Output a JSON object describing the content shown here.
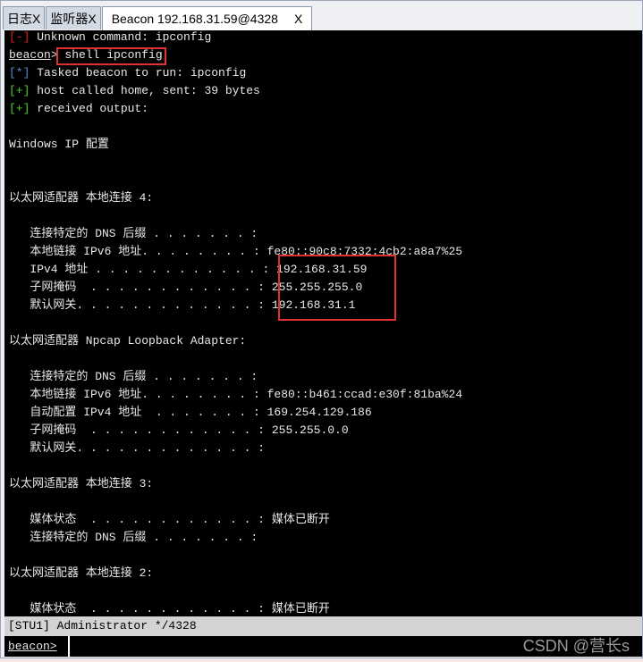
{
  "tabs": [
    {
      "label": "日志X"
    },
    {
      "label": "监听器X"
    },
    {
      "label": "Beacon 192.168.31.59@4328",
      "close": "X"
    }
  ],
  "terminal": {
    "lines": [
      {
        "prefix": "[-]",
        "prefix_color": "red",
        "text": " Unknown command: ipconfig"
      },
      {
        "prompt": "beacon",
        "text": "> shell ipconfig"
      },
      {
        "prefix": "[*]",
        "prefix_color": "blue",
        "text": " Tasked beacon to run: ipconfig"
      },
      {
        "prefix": "[+]",
        "prefix_color": "green",
        "text": " host called home, sent: 39 bytes"
      },
      {
        "prefix": "[+]",
        "prefix_color": "green",
        "text": " received output:"
      },
      {
        "text": ""
      },
      {
        "text": "Windows IP 配置"
      },
      {
        "text": ""
      },
      {
        "text": ""
      },
      {
        "text": "以太网适配器 本地连接 4:"
      },
      {
        "text": ""
      },
      {
        "text": "   连接特定的 DNS 后缀 . . . . . . . :"
      },
      {
        "text": "   本地链接 IPv6 地址. . . . . . . . : fe80::90c8:7332:4cb2:a8a7%25"
      },
      {
        "text": "   IPv4 地址 . . . . . . . . . . . . : 192.168.31.59"
      },
      {
        "text": "   子网掩码  . . . . . . . . . . . . : 255.255.255.0"
      },
      {
        "text": "   默认网关. . . . . . . . . . . . . : 192.168.31.1"
      },
      {
        "text": ""
      },
      {
        "text": "以太网适配器 Npcap Loopback Adapter:"
      },
      {
        "text": ""
      },
      {
        "text": "   连接特定的 DNS 后缀 . . . . . . . :"
      },
      {
        "text": "   本地链接 IPv6 地址. . . . . . . . : fe80::b461:ccad:e30f:81ba%24"
      },
      {
        "text": "   自动配置 IPv4 地址  . . . . . . . : 169.254.129.186"
      },
      {
        "text": "   子网掩码  . . . . . . . . . . . . : 255.255.0.0"
      },
      {
        "text": "   默认网关. . . . . . . . . . . . . :"
      },
      {
        "text": ""
      },
      {
        "text": "以太网适配器 本地连接 3:"
      },
      {
        "text": ""
      },
      {
        "text": "   媒体状态  . . . . . . . . . . . . : 媒体已断开"
      },
      {
        "text": "   连接特定的 DNS 后缀 . . . . . . . :"
      },
      {
        "text": ""
      },
      {
        "text": "以太网适配器 本地连接 2:"
      },
      {
        "text": ""
      },
      {
        "text": "   媒体状态  . . . . . . . . . . . . : 媒体已断开"
      }
    ]
  },
  "status_bar": "[STU1] Administrator */4328",
  "input": {
    "prompt": "beacon>",
    "value": ""
  },
  "watermark": "CSDN @营长s",
  "colors": {
    "highlight_box": "#e03030",
    "terminal_bg": "#000000"
  }
}
